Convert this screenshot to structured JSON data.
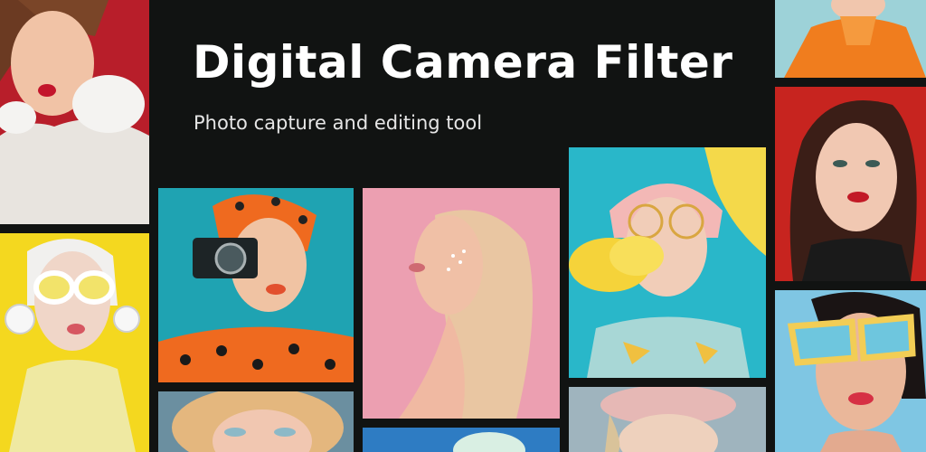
{
  "banner": {
    "title": "Digital Camera Filter",
    "subtitle": "Photo capture and editing tool"
  },
  "colors": {
    "background": "#111312",
    "title_text": "#ffffff",
    "subtitle_text": "#e6e6e6"
  },
  "photos": [
    "woman-blowing-kiss-red-background",
    "woman-white-headphones-yellow-background",
    "woman-polka-dot-camera-teal-background",
    "blonde-woman-glitter-pink-background",
    "woman-pink-hair-yellow-smoke-teal-background",
    "woman-brown-hair-red-background",
    "woman-yellow-sunglasses-blue-background",
    "woman-orange-jacket-cyan-background"
  ]
}
